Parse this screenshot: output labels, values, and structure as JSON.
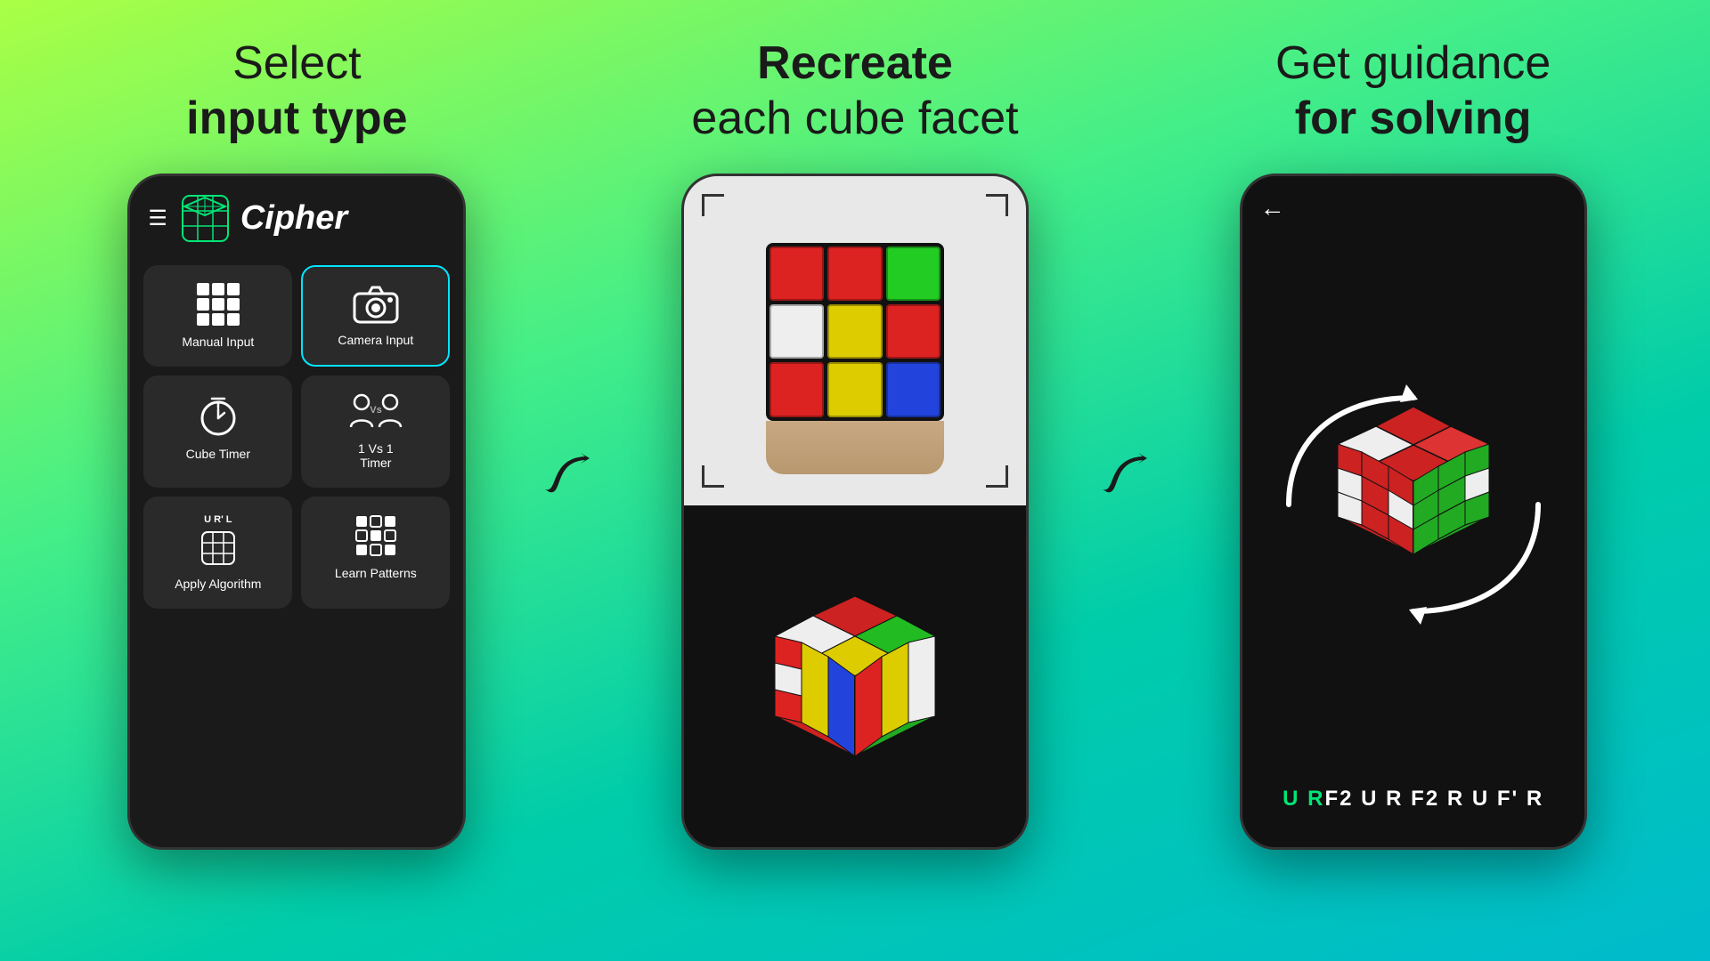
{
  "sections": [
    {
      "id": "select-input",
      "title_line1": "Select",
      "title_line2_bold": "input type",
      "title_line2_normal": ""
    },
    {
      "id": "recreate",
      "title_line1_normal": "Recreate",
      "title_line2_normal": "each cube facet"
    },
    {
      "id": "guidance",
      "title_line1": "Get guidance",
      "title_line2_bold": "for solving"
    }
  ],
  "app": {
    "name": "Cipher",
    "menu_items": [
      {
        "id": "manual-input",
        "label": "Manual Input",
        "icon": "grid"
      },
      {
        "id": "camera-input",
        "label": "Camera Input",
        "icon": "camera",
        "selected": true
      },
      {
        "id": "cube-timer",
        "label": "Cube Timer",
        "icon": "timer"
      },
      {
        "id": "1vs1",
        "label": "1 Vs 1\nTimer",
        "icon": "vs"
      },
      {
        "id": "algorithm",
        "label": "Apply Algorithm",
        "icon": "algorithm"
      },
      {
        "id": "patterns",
        "label": "Learn Patterns",
        "icon": "patterns"
      }
    ]
  },
  "camera_face": [
    [
      "red",
      "red",
      "green"
    ],
    [
      "white",
      "yellow",
      "red"
    ],
    [
      "red",
      "yellow",
      "blue"
    ]
  ],
  "cube_3d_face": [
    [
      "red",
      "green",
      "white"
    ],
    [
      "white",
      "yellow",
      "red"
    ],
    [
      "red",
      "yellow",
      "blue"
    ]
  ],
  "algorithm": {
    "sequence": "URF2URF2RUF'R",
    "colored_letters": [
      "U",
      "R"
    ],
    "normal_letters": "F2URF2RUF'R"
  },
  "colors": {
    "background_start": "#aaff44",
    "background_end": "#00bbcc",
    "accent": "#00e5ff",
    "app_bg": "#1a1a1a",
    "menu_bg": "#2a2a2a",
    "green_text": "#00e676"
  }
}
